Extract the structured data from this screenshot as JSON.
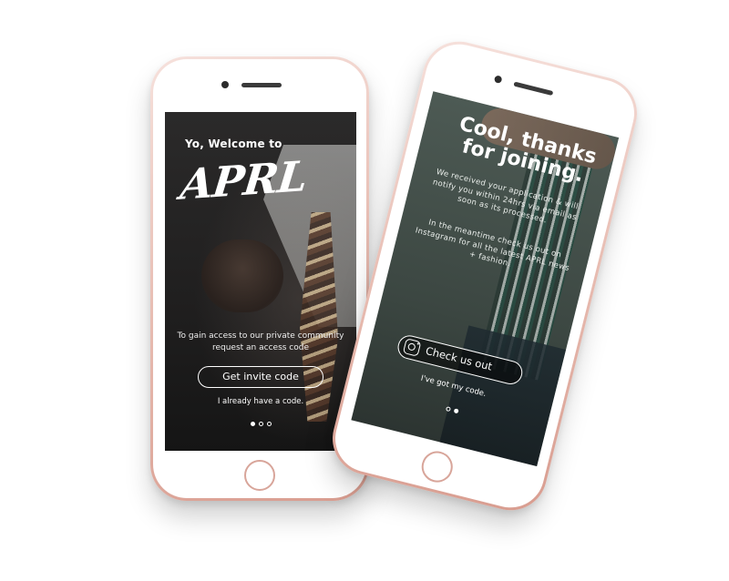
{
  "screen1": {
    "welcome": "Yo, Welcome to",
    "logo": "APRL",
    "access_text": "To gain access to our private community request an access code",
    "invite_button": "Get invite code",
    "have_code_link": "I already have a code."
  },
  "screen2": {
    "title": "Cool, thanks for joining.",
    "received_text": "We received your application & will notify you within 24hrs via email as soon as its processed.",
    "meantime_text": "In the meantime check us out on Instagram for all the latest APRL news + fashion.",
    "check_button": "Check us out",
    "got_code_link": "I've got my code."
  },
  "pagination": {
    "screen1_active_index": 0,
    "screen1_total": 3,
    "screen2_active_index": 1,
    "screen2_total": 2
  },
  "colors": {
    "phone_body": "#e6b9ae",
    "screen1_bg": "#1f1e1e",
    "screen2_bg": "#3c4742"
  }
}
